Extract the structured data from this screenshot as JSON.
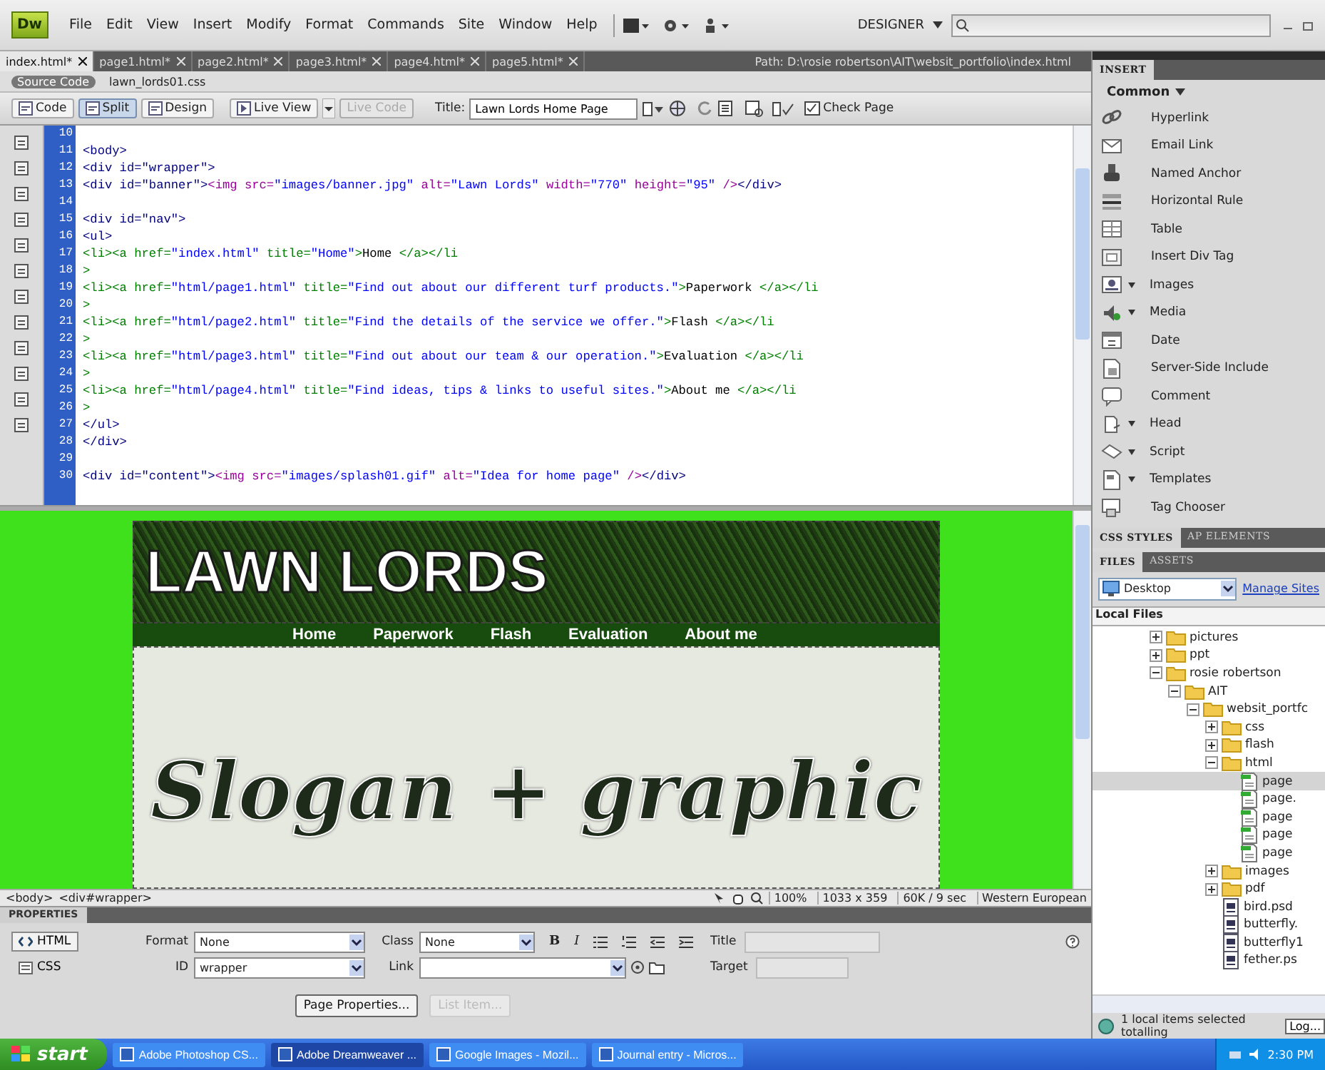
{
  "menubar": {
    "logo": "Dw",
    "menus": [
      "File",
      "Edit",
      "View",
      "Insert",
      "Modify",
      "Format",
      "Commands",
      "Site",
      "Window",
      "Help"
    ],
    "workspace": "DESIGNER"
  },
  "doc_tabs": [
    {
      "label": "index.html*",
      "selected": true
    },
    {
      "label": "page1.html*",
      "selected": false
    },
    {
      "label": "page2.html*",
      "selected": false
    },
    {
      "label": "page3.html*",
      "selected": false
    },
    {
      "label": "page4.html*",
      "selected": false
    },
    {
      "label": "page5.html*",
      "selected": false
    }
  ],
  "path": "Path: D:\\rosie robertson\\AIT\\websit_portfolio\\index.html",
  "related_files": [
    {
      "label": "Source Code",
      "selected": true
    },
    {
      "label": "lawn_lords01.css",
      "selected": false
    }
  ],
  "toolbar": {
    "views": [
      {
        "label": "Code",
        "selected": false
      },
      {
        "label": "Split",
        "selected": true
      },
      {
        "label": "Design",
        "selected": false
      }
    ],
    "live_view": "Live View",
    "live_code": {
      "label": "Live Code",
      "disabled": true
    },
    "title_label": "Title:",
    "title_value": "Lawn Lords Home Page",
    "check_page": "Check Page"
  },
  "code": {
    "lines": [
      {
        "number": "10"
      },
      {
        "number": "11",
        "segments": [
          {
            "kind": "tag",
            "text": "<body>"
          }
        ]
      },
      {
        "number": "12",
        "segments": [
          {
            "kind": "tag",
            "text": "<div id=\"wrapper\">"
          }
        ]
      },
      {
        "number": "13",
        "segments": [
          {
            "kind": "tag",
            "text": "<div id=\"banner\">"
          },
          {
            "kind": "img",
            "text": "<img src="
          },
          {
            "kind": "value",
            "text": "\"images/banner.jpg\""
          },
          {
            "kind": "img",
            "text": " alt="
          },
          {
            "kind": "value",
            "text": "\"Lawn Lords\""
          },
          {
            "kind": "img",
            "text": " width="
          },
          {
            "kind": "value",
            "text": "\"770\""
          },
          {
            "kind": "img",
            "text": " height="
          },
          {
            "kind": "value",
            "text": "\"95\""
          },
          {
            "kind": "img",
            "text": " />"
          },
          {
            "kind": "tag",
            "text": "</div>"
          }
        ]
      },
      {
        "number": "14"
      },
      {
        "number": "15",
        "segments": [
          {
            "kind": "tag",
            "text": "<div id=\"nav\">"
          }
        ]
      },
      {
        "number": "16",
        "segments": [
          {
            "kind": "tag",
            "text": "<ul>"
          }
        ]
      },
      {
        "number": "17",
        "segments": [
          {
            "kind": "link",
            "text": "<li><a href="
          },
          {
            "kind": "value",
            "text": "\"index.html\""
          },
          {
            "kind": "link",
            "text": " title="
          },
          {
            "kind": "value",
            "text": "\"Home\""
          },
          {
            "kind": "link",
            "text": ">"
          },
          {
            "kind": "text",
            "text": "Home "
          },
          {
            "kind": "link",
            "text": "</a></li"
          }
        ]
      },
      {
        "number": "18",
        "segments": [
          {
            "kind": "link",
            "text": ">"
          }
        ]
      },
      {
        "number": "19",
        "segments": [
          {
            "kind": "link",
            "text": "<li><a href="
          },
          {
            "kind": "value",
            "text": "\"html/page1.html\""
          },
          {
            "kind": "link",
            "text": " title="
          },
          {
            "kind": "value",
            "text": "\"Find out about our different turf products.\""
          },
          {
            "kind": "link",
            "text": ">"
          },
          {
            "kind": "text",
            "text": "Paperwork "
          },
          {
            "kind": "link",
            "text": "</a></li"
          }
        ]
      },
      {
        "number": "20",
        "segments": [
          {
            "kind": "link",
            "text": ">"
          }
        ]
      },
      {
        "number": "21",
        "segments": [
          {
            "kind": "link",
            "text": "<li><a href="
          },
          {
            "kind": "value",
            "text": "\"html/page2.html\""
          },
          {
            "kind": "link",
            "text": " title="
          },
          {
            "kind": "value",
            "text": "\"Find the details of the service we offer.\""
          },
          {
            "kind": "link",
            "text": ">"
          },
          {
            "kind": "text",
            "text": "Flash "
          },
          {
            "kind": "link",
            "text": "</a></li"
          }
        ]
      },
      {
        "number": "22",
        "segments": [
          {
            "kind": "link",
            "text": ">"
          }
        ]
      },
      {
        "number": "23",
        "segments": [
          {
            "kind": "link",
            "text": "<li><a href="
          },
          {
            "kind": "value",
            "text": "\"html/page3.html\""
          },
          {
            "kind": "link",
            "text": " title="
          },
          {
            "kind": "value",
            "text": "\"Find out about our team & our operation.\""
          },
          {
            "kind": "link",
            "text": ">"
          },
          {
            "kind": "text",
            "text": "Evaluation "
          },
          {
            "kind": "link",
            "text": "</a></li"
          }
        ]
      },
      {
        "number": "24",
        "segments": [
          {
            "kind": "link",
            "text": ">"
          }
        ]
      },
      {
        "number": "25",
        "segments": [
          {
            "kind": "link",
            "text": "<li><a href="
          },
          {
            "kind": "value",
            "text": "\"html/page4.html\""
          },
          {
            "kind": "link",
            "text": " title="
          },
          {
            "kind": "value",
            "text": "\"Find ideas, tips & links to useful sites.\""
          },
          {
            "kind": "link",
            "text": ">"
          },
          {
            "kind": "text",
            "text": "About me "
          },
          {
            "kind": "link",
            "text": "</a></li"
          }
        ]
      },
      {
        "number": "26",
        "segments": [
          {
            "kind": "link",
            "text": ">"
          }
        ]
      },
      {
        "number": "27",
        "segments": [
          {
            "kind": "tag",
            "text": "</ul>"
          }
        ]
      },
      {
        "number": "28",
        "segments": [
          {
            "kind": "tag",
            "text": "</div>"
          }
        ]
      },
      {
        "number": "29"
      },
      {
        "number": "30",
        "segments": [
          {
            "kind": "tag",
            "text": "<div id=\"content\">"
          },
          {
            "kind": "img",
            "text": "<img src="
          },
          {
            "kind": "value",
            "text": "\"images/splash01.gif\""
          },
          {
            "kind": "img",
            "text": " alt="
          },
          {
            "kind": "value",
            "text": "\"Idea for home page\""
          },
          {
            "kind": "img",
            "text": " />"
          },
          {
            "kind": "tag",
            "text": "</div>"
          }
        ]
      }
    ]
  },
  "design_view": {
    "banner_text": "LAWN LORDS",
    "nav": [
      "Home",
      "Paperwork",
      "Flash",
      "Evaluation",
      "About me"
    ],
    "splash_text": "Slogan + graphic"
  },
  "tag_selector": [
    "<body>",
    "<div#wrapper>"
  ],
  "status": {
    "zoom": "100%",
    "size": "1033 x 359",
    "download": "60K / 9 sec",
    "encoding": "Western European"
  },
  "properties": {
    "title": "PROPERTIES",
    "modes": [
      {
        "label": "HTML",
        "selected": true
      },
      {
        "label": "CSS",
        "selected": false
      }
    ],
    "format": {
      "label": "Format",
      "value": "None"
    },
    "id": {
      "label": "ID",
      "value": "wrapper"
    },
    "class": {
      "label": "Class",
      "value": "None"
    },
    "link": {
      "label": "Link"
    },
    "bold": "B",
    "italic": "I",
    "title_field": {
      "label": "Title",
      "disabled": true
    },
    "target": {
      "label": "Target",
      "disabled": true
    },
    "buttons": [
      {
        "label": "Page Properties...",
        "disabled": false
      },
      {
        "label": "List Item...",
        "disabled": true
      }
    ]
  },
  "insert_panel": {
    "tab": "INSERT",
    "category": "Common",
    "items": [
      {
        "label": "Hyperlink",
        "has_menu": false
      },
      {
        "label": "Email Link",
        "has_menu": false
      },
      {
        "label": "Named Anchor",
        "has_menu": false
      },
      {
        "label": "Horizontal Rule",
        "has_menu": false
      },
      {
        "label": "Table",
        "has_menu": false
      },
      {
        "label": "Insert Div Tag",
        "has_menu": false
      },
      {
        "label": "Images",
        "has_menu": true
      },
      {
        "label": "Media",
        "has_menu": true
      },
      {
        "label": "Date",
        "has_menu": false
      },
      {
        "label": "Server-Side Include",
        "has_menu": false
      },
      {
        "label": "Comment",
        "has_menu": false
      },
      {
        "label": "Head",
        "has_menu": true
      },
      {
        "label": "Script",
        "has_menu": true
      },
      {
        "label": "Templates",
        "has_menu": true
      },
      {
        "label": "Tag Chooser",
        "has_menu": false
      }
    ]
  },
  "css_tabs": [
    {
      "label": "CSS STYLES",
      "selected": true
    },
    {
      "label": "AP ELEMENTS",
      "selected": false
    }
  ],
  "files_panel": {
    "tabs": [
      {
        "label": "FILES",
        "selected": true
      },
      {
        "label": "ASSETS",
        "selected": false
      }
    ],
    "site": "Desktop",
    "manage": "Manage Sites",
    "header": "Local Files",
    "tree": [
      {
        "label": "pictures",
        "kind": "folder",
        "expanded": false,
        "selected": false
      },
      {
        "label": "ppt",
        "kind": "folder",
        "expanded": false,
        "selected": false
      },
      {
        "label": "rosie robertson",
        "kind": "folder",
        "expanded": true,
        "selected": false,
        "children": [
          {
            "label": "AIT",
            "kind": "folder",
            "expanded": true,
            "selected": false,
            "children": [
              {
                "label": "websit_portfc",
                "kind": "folder",
                "expanded": true,
                "selected": false,
                "children": [
                  {
                    "label": "css",
                    "kind": "folder",
                    "expanded": false,
                    "selected": false
                  },
                  {
                    "label": "flash",
                    "kind": "folder",
                    "expanded": false,
                    "selected": false
                  },
                  {
                    "label": "html",
                    "kind": "folder",
                    "expanded": true,
                    "selected": false,
                    "children": [
                      {
                        "label": "page",
                        "kind": "page",
                        "selected": true
                      },
                      {
                        "label": "page.",
                        "kind": "page",
                        "selected": false
                      },
                      {
                        "label": "page",
                        "kind": "page",
                        "selected": false
                      },
                      {
                        "label": "page",
                        "kind": "page",
                        "selected": false
                      },
                      {
                        "label": "page",
                        "kind": "page",
                        "selected": false
                      }
                    ]
                  },
                  {
                    "label": "images",
                    "kind": "folder",
                    "expanded": false,
                    "selected": false
                  },
                  {
                    "label": "pdf",
                    "kind": "folder",
                    "expanded": false,
                    "selected": false
                  },
                  {
                    "label": "bird.psd",
                    "kind": "psd",
                    "selected": false
                  },
                  {
                    "label": "butterfly.",
                    "kind": "psd",
                    "selected": false
                  },
                  {
                    "label": "butterfly1",
                    "kind": "psd",
                    "selected": false
                  },
                  {
                    "label": "fether.ps",
                    "kind": "psd",
                    "selected": false
                  }
                ]
              }
            ]
          }
        ]
      }
    ],
    "status": "1 local items selected totalling",
    "log": "Log..."
  },
  "taskbar": {
    "start": "start",
    "tasks": [
      {
        "label": "Adobe Photoshop CS...",
        "selected": false
      },
      {
        "label": "Adobe Dreamweaver ...",
        "selected": true
      },
      {
        "label": "Google Images - Mozil...",
        "selected": false
      },
      {
        "label": "Journal entry - Micros...",
        "selected": false
      }
    ],
    "clock": "2:30 PM"
  }
}
